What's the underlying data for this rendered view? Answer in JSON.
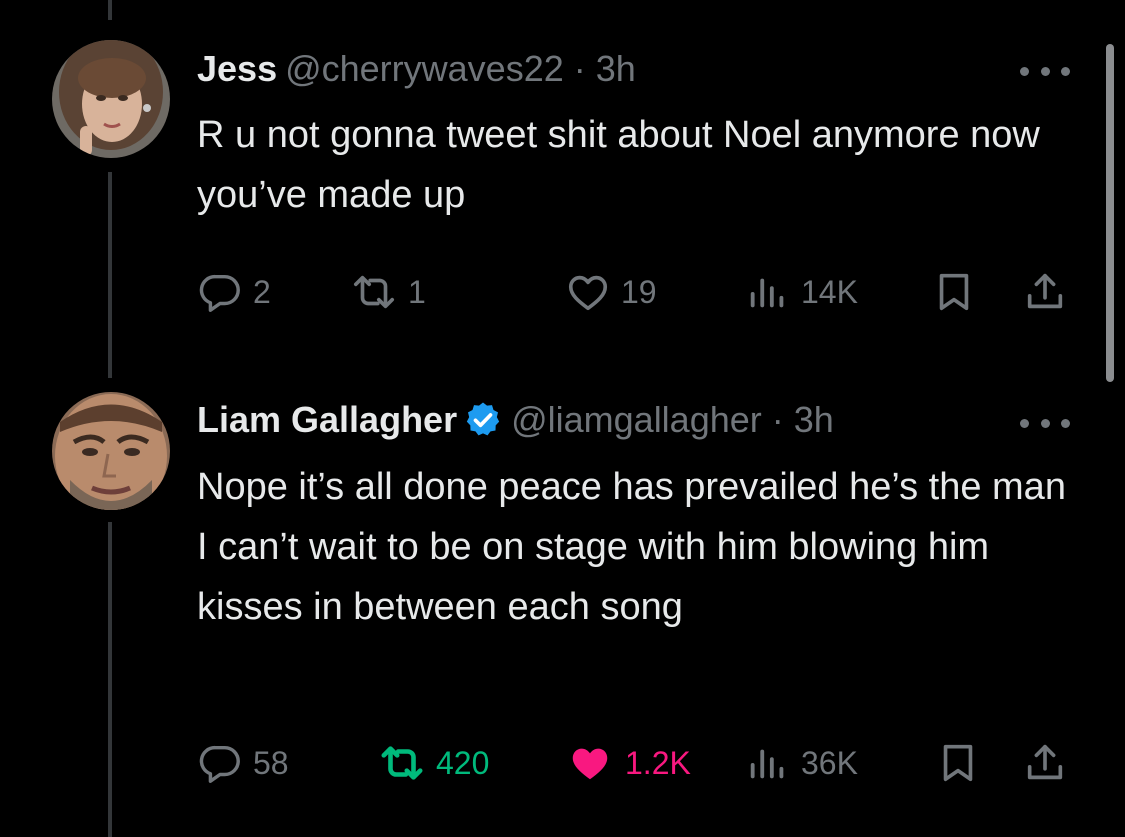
{
  "colors": {
    "background": "#000000",
    "text_primary": "#e7e9ea",
    "text_secondary": "#71767b",
    "verified_blue": "#1d9bf0",
    "retweet_green": "#00ba7c",
    "like_pink": "#f91880"
  },
  "tweets": [
    {
      "display_name": "Jess",
      "handle": "@cherrywaves22",
      "separator": "·",
      "time": "3h",
      "verified": false,
      "text": "R u not gonna tweet shit about Noel anymore now you’ve made up",
      "stats": {
        "replies": "2",
        "retweets": "1",
        "likes": "19",
        "views": "14K"
      },
      "retweeted": false,
      "liked": false
    },
    {
      "display_name": "Liam Gallagher",
      "handle": "@liamgallagher",
      "separator": "·",
      "time": "3h",
      "verified": true,
      "text": "Nope it’s all done peace has prevailed he’s the man I can’t wait to be on stage with him blowing him kisses in between each song",
      "stats": {
        "replies": "58",
        "retweets": "420",
        "likes": "1.2K",
        "views": "36K"
      },
      "retweeted": true,
      "liked": true
    }
  ],
  "icons": {
    "reply": "reply-icon",
    "retweet": "retweet-icon",
    "like": "heart-icon",
    "views": "views-chart-icon",
    "bookmark": "bookmark-icon",
    "share": "share-icon",
    "more": "more-dots-icon",
    "verified": "verified-badge-icon"
  }
}
